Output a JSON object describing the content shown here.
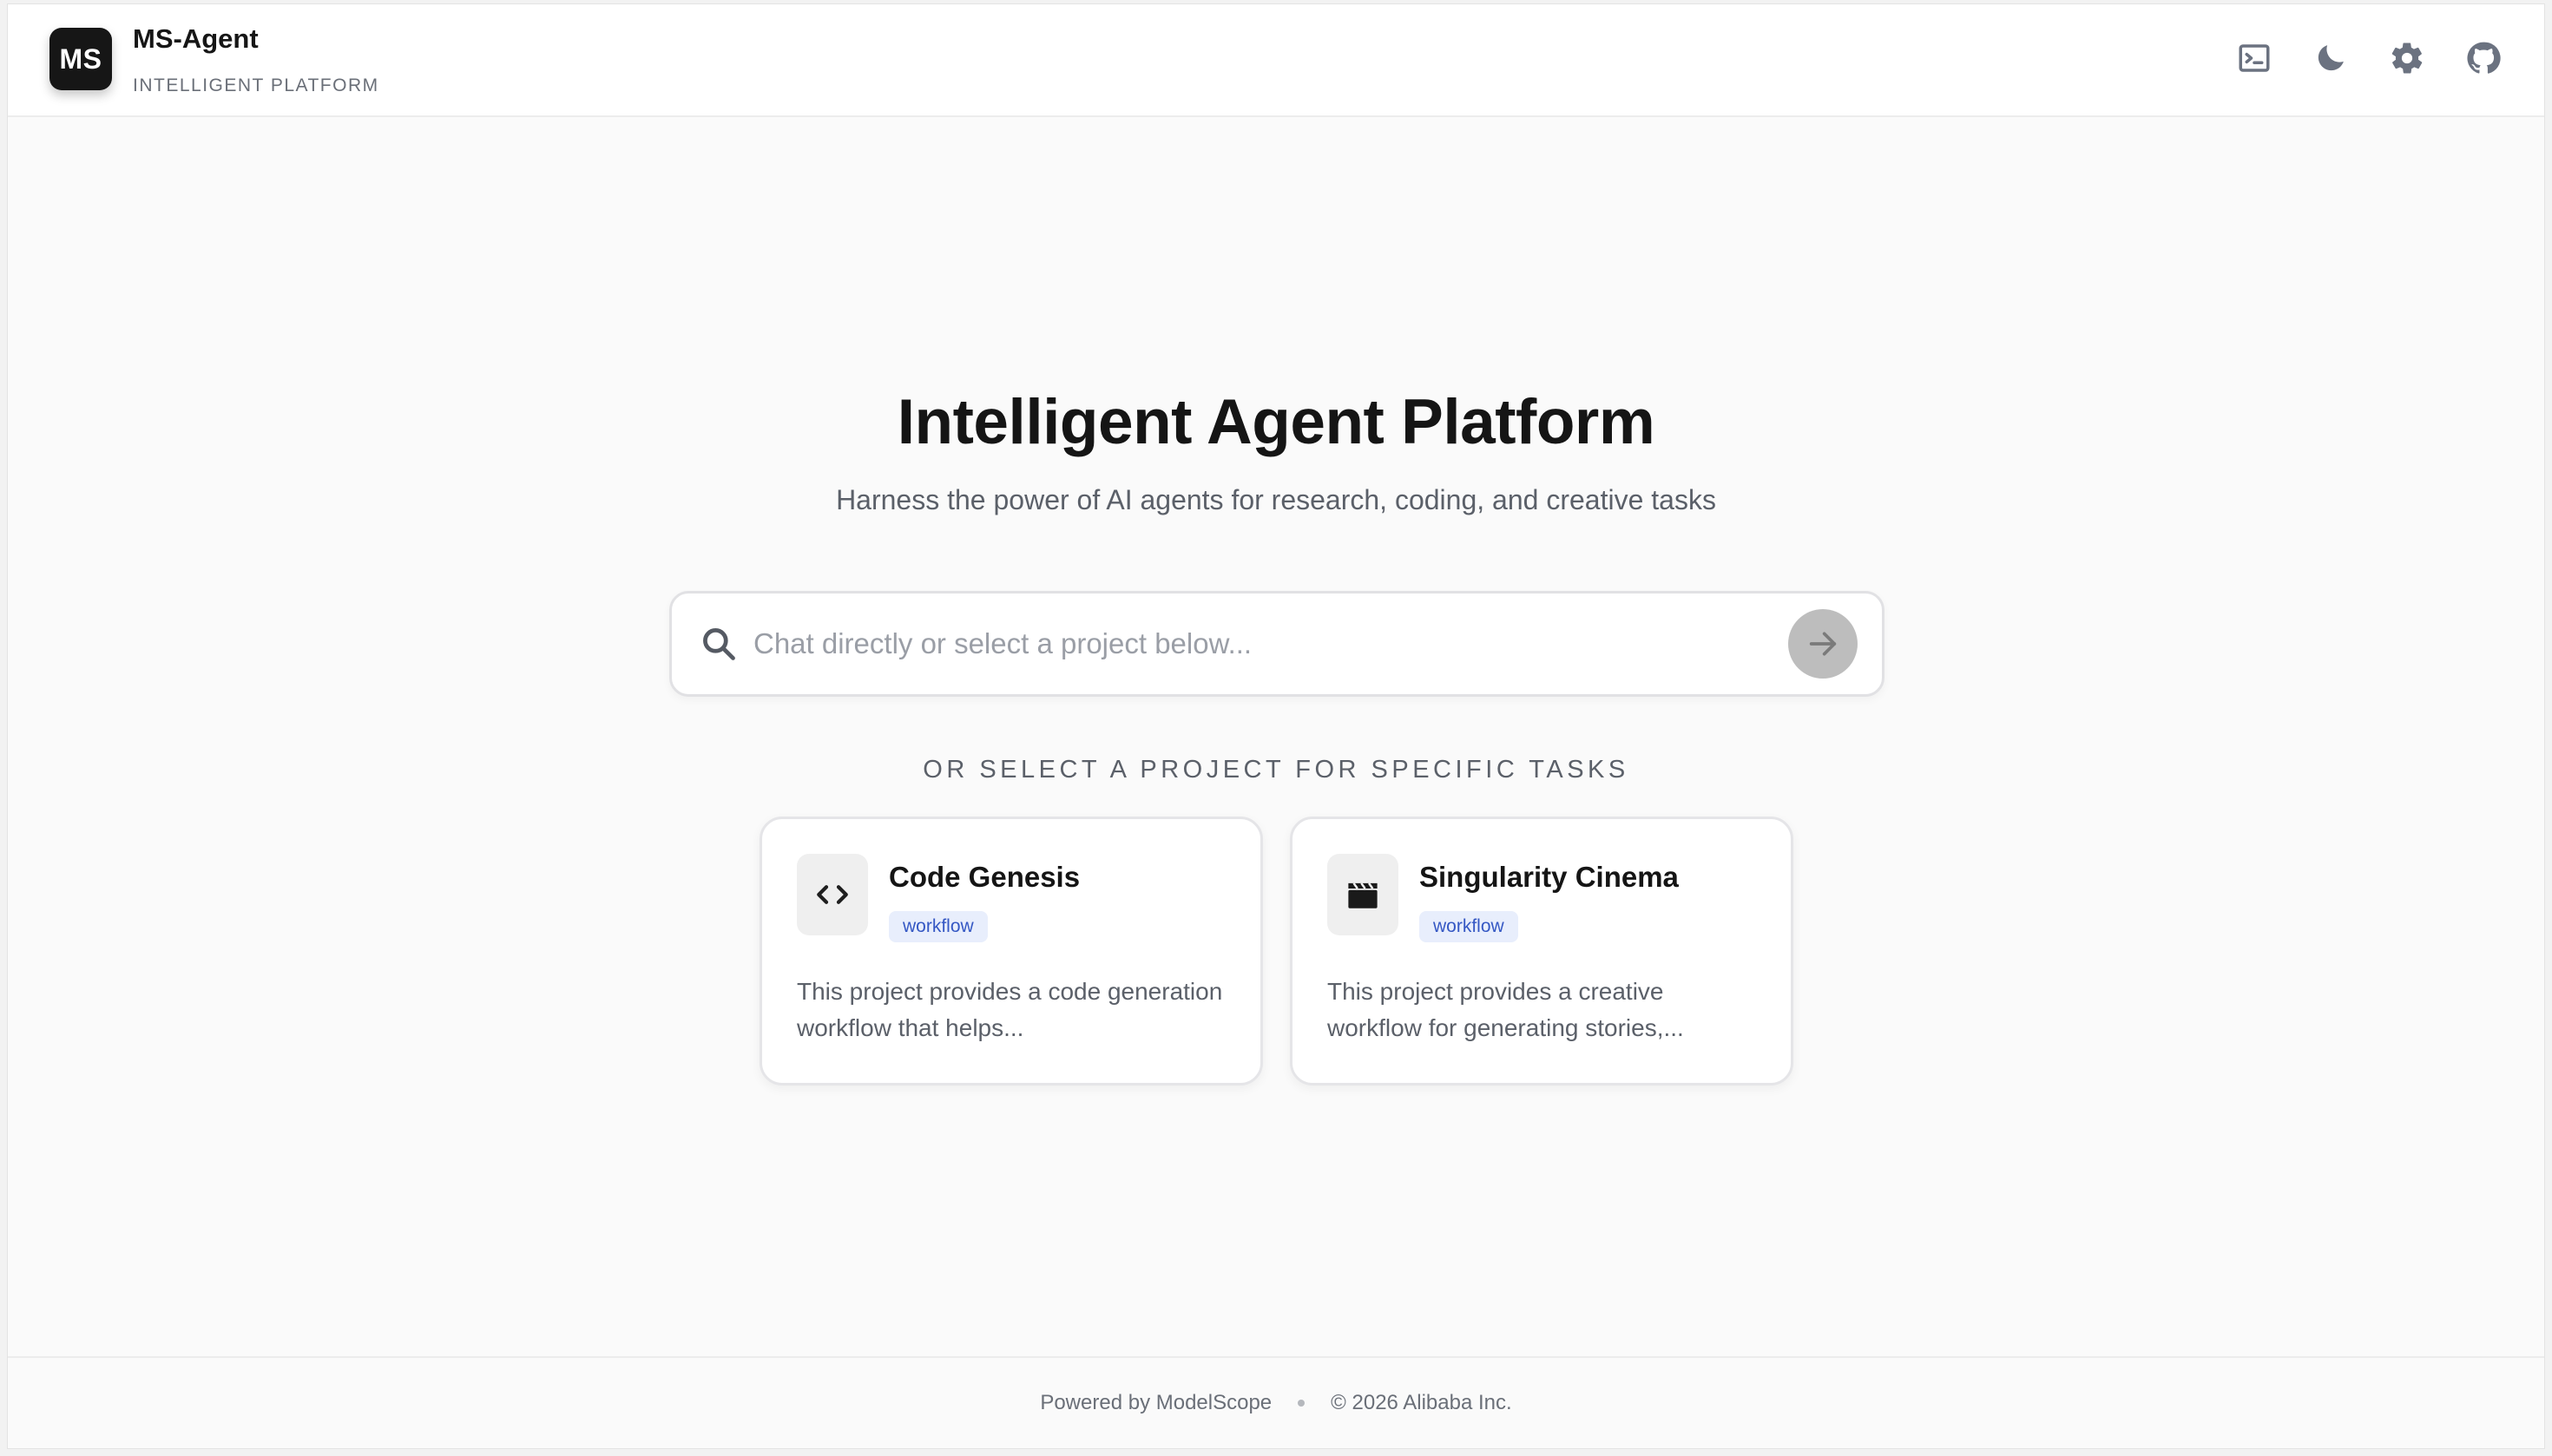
{
  "header": {
    "logo_text": "MS",
    "app_name": "MS-Agent",
    "tagline": "INTELLIGENT PLATFORM",
    "icons": [
      "terminal-icon",
      "moon-icon",
      "gear-icon",
      "github-icon"
    ]
  },
  "hero": {
    "title": "Intelligent Agent Platform",
    "subtitle": "Harness the power of AI agents for research, coding, and creative tasks"
  },
  "search": {
    "placeholder": "Chat directly or select a project below...",
    "value": "",
    "icon": "search-icon",
    "send_icon": "arrow-right-icon"
  },
  "projects": {
    "section_label": "OR SELECT A PROJECT FOR SPECIFIC TASKS",
    "items": [
      {
        "title": "Code Genesis",
        "badge": "workflow",
        "icon": "code-icon",
        "description": "This project provides a code generation workflow that helps..."
      },
      {
        "title": "Singularity Cinema",
        "badge": "workflow",
        "icon": "clapperboard-icon",
        "description": "This project provides a creative workflow for generating stories,..."
      }
    ]
  },
  "footer": {
    "powered_by": "Powered by ModelScope",
    "copyright": "© 2026 Alibaba Inc."
  },
  "colors": {
    "background": "#fafafa",
    "logo_bg": "#161616",
    "badge_bg": "#e8eefc",
    "badge_text": "#3558c4",
    "send_button": "#bdbdbd",
    "icon_gray": "#6b7280"
  }
}
